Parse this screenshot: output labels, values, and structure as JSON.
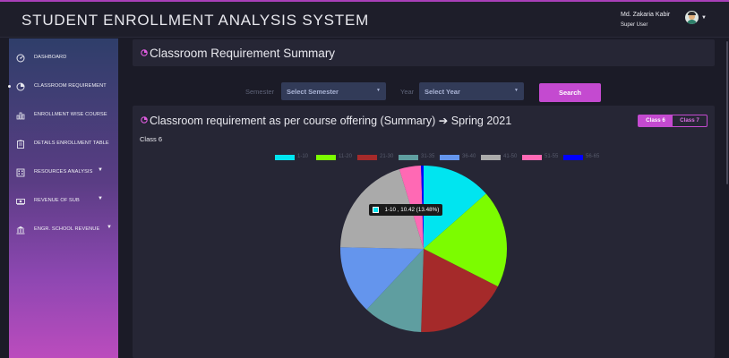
{
  "app": {
    "title": "STUDENT ENROLLMENT ANALYSIS SYSTEM"
  },
  "user": {
    "name": "Md. Zakaria Kabir",
    "role": "Super User",
    "avatar_icon": "user-avatar-icon"
  },
  "sidebar": {
    "items": [
      {
        "label": "DASHBOARD",
        "icon": "dashboard-gauge-icon"
      },
      {
        "label": "CLASSROOM REQUIREMENT",
        "icon": "pie-chart-icon",
        "active": true
      },
      {
        "label": "ENROLLMENT WISE COURSE",
        "icon": "bar-chart-icon"
      },
      {
        "label": "DETAILS ENROLLMENT TABLE",
        "icon": "clipboard-icon"
      },
      {
        "label": "RESOURCES ANALYSIS",
        "icon": "building-icon",
        "has_submenu": true
      },
      {
        "label": "REVENUE OF SUB",
        "icon": "money-icon",
        "has_submenu": true
      },
      {
        "label": "ENGR. SCHOOL REVENUE",
        "icon": "bank-icon",
        "has_submenu": true
      }
    ]
  },
  "page": {
    "title": "Classroom Requirement Summary"
  },
  "filters": {
    "semester_label": "Semester",
    "semester_value": "Select Semester",
    "year_label": "Year",
    "year_value": "Select Year",
    "search_label": "Search"
  },
  "chart_panel": {
    "title": "Classroom requirement as per course offering (Summary) ➔ Spring 2021",
    "tabs": [
      "Class 6",
      "Class 7"
    ],
    "active_tab": "Class 6",
    "subtitle": "Class 6",
    "tooltip": "1-10 , 10.42 (13.48%)"
  },
  "chart_data": {
    "type": "pie",
    "title": "Class 6",
    "legend_position": "top",
    "categories": [
      "1-10",
      "11-20",
      "21-30",
      "31-35",
      "36-40",
      "41-50",
      "51-55",
      "56-65"
    ],
    "values": [
      13.48,
      19.0,
      18.0,
      11.5,
      13.3,
      20.0,
      4.2,
      0.5
    ],
    "colors": [
      "#00e5f0",
      "#7cfc00",
      "#a52a2a",
      "#5f9ea0",
      "#6495ed",
      "#aaaaaa",
      "#ff69b4",
      "#0000ff"
    ]
  }
}
